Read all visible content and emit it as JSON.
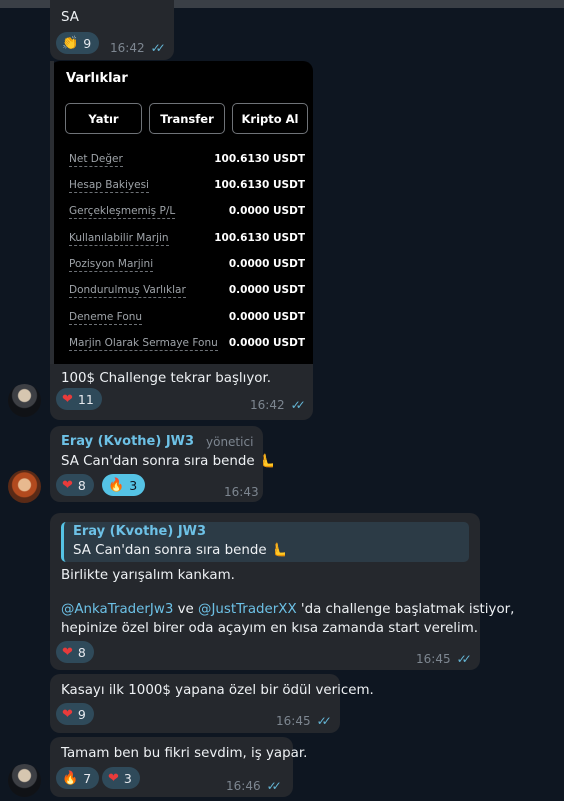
{
  "msg1": {
    "text": "SA",
    "reaction": {
      "emoji": "👏",
      "count": "9"
    },
    "time": "16:42"
  },
  "card": {
    "title": "Varlıklar",
    "buttons": [
      "Yatır",
      "Transfer",
      "Kripto Al"
    ],
    "rows": [
      {
        "label": "Net Değer",
        "value": "100.6130 USDT"
      },
      {
        "label": "Hesap Bakiyesi",
        "value": "100.6130 USDT"
      },
      {
        "label": "Gerçekleşmemiş P/L",
        "value": "0.0000 USDT"
      },
      {
        "label": "Kullanılabilir Marjin",
        "value": "100.6130 USDT"
      },
      {
        "label": "Pozisyon Marjini",
        "value": "0.0000 USDT"
      },
      {
        "label": "Dondurulmuş Varlıklar",
        "value": "0.0000 USDT"
      },
      {
        "label": "Deneme Fonu",
        "value": "0.0000 USDT"
      },
      {
        "label": "Marjin Olarak Sermaye Fonu",
        "value": "0.0000 USDT"
      }
    ]
  },
  "msg2": {
    "text": "100$ Challenge tekrar başlıyor.",
    "reaction": {
      "emoji": "❤",
      "count": "11"
    },
    "time": "16:42"
  },
  "msg3": {
    "author": "Eray (Kvothe) JW3",
    "role": "yönetici",
    "text": "SA Can'dan sonra sıra bende 🫷",
    "reactions": [
      {
        "emoji": "❤",
        "count": "8"
      },
      {
        "emoji": "🔥",
        "count": "3"
      }
    ],
    "time": "16:43"
  },
  "msg4": {
    "quote_author": "Eray (Kvothe) JW3",
    "quote_text": "SA Can'dan sonra sıra bende 🫷",
    "line1": "Birlikte yarışalım kankam.",
    "mention1": "@AnkaTraderJw3",
    "connector": " ve ",
    "mention2": "@JustTraderXX",
    "line2_rest": " 'da challenge başlatmak istiyor,",
    "line3": "hepinize özel birer oda açayım en kısa zamanda start verelim.",
    "reaction": {
      "emoji": "❤",
      "count": "8"
    },
    "time": "16:45"
  },
  "msg5": {
    "text": "Kasayı ilk 1000$ yapana özel bir ödül vericem.",
    "reaction": {
      "emoji": "❤",
      "count": "9"
    },
    "time": "16:45"
  },
  "msg6": {
    "text": "Tamam ben bu fikri sevdim, iş yapar.",
    "reactions": [
      {
        "emoji": "🔥",
        "count": "7"
      },
      {
        "emoji": "❤",
        "count": "3"
      }
    ],
    "time": "16:46"
  },
  "colors": {
    "accent": "#55c3e5",
    "bubble": "#25282d",
    "background": "#0e1621",
    "heart": "#e83b3b"
  }
}
